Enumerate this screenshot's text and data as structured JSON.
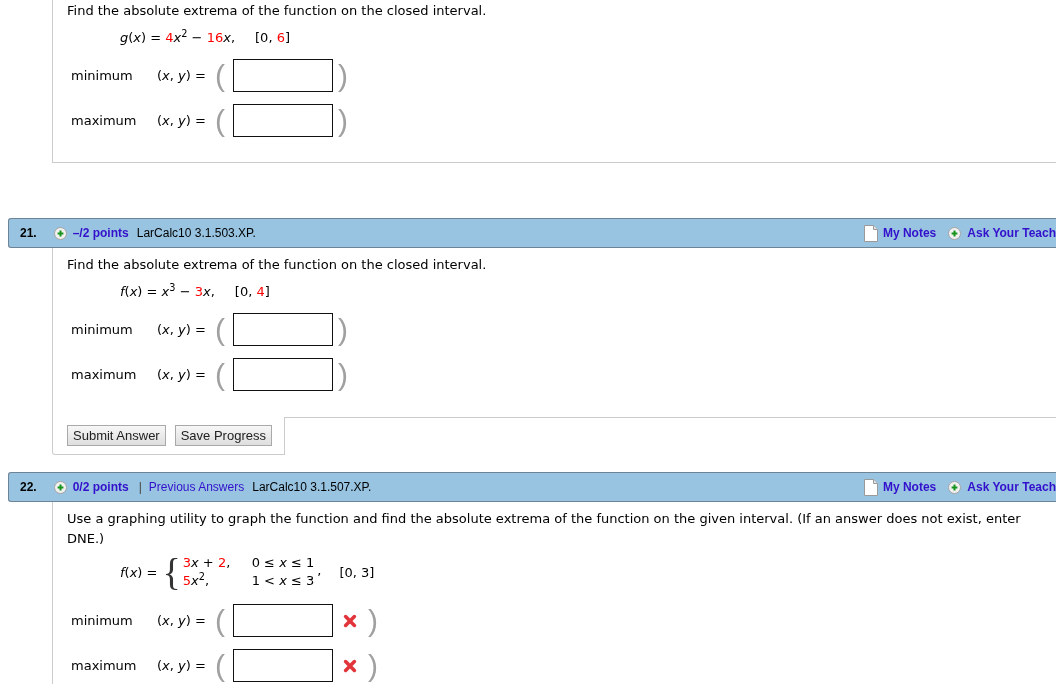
{
  "questions": [
    {
      "prompt": "Find the absolute extrema of the function on the closed interval.",
      "formula": {
        "kind": "simple",
        "parts": [
          {
            "text": "*g*(*x*) = "
          },
          {
            "text": "4",
            "color": "#ff0000"
          },
          {
            "text": "*x*$^{2}$ − "
          },
          {
            "text": "16",
            "color": "#ff0000"
          },
          {
            "text": "*x*,"
          }
        ],
        "interval": [
          {
            "text": "[0, "
          },
          {
            "text": "6",
            "color": "#ff0000"
          },
          {
            "text": "]"
          }
        ]
      },
      "answers": [
        {
          "label": "minimum",
          "point": "(*x*, *y*) =",
          "open": "(",
          "close": ")",
          "incorrect": false
        },
        {
          "label": "maximum",
          "point": "(*x*, *y*) =",
          "open": "(",
          "close": ")",
          "incorrect": false
        }
      ]
    },
    {
      "header": {
        "number": "21.",
        "points": "–/2 points",
        "source": "LarCalc10 3.1.503.XP.",
        "notes": "My Notes",
        "ask": "Ask Your Teach"
      },
      "prompt": "Find the absolute extrema of the function on the closed interval.",
      "formula": {
        "kind": "simple",
        "parts": [
          {
            "text": "*f*(*x*) = *x*$^{3}$ − "
          },
          {
            "text": "3",
            "color": "#ff0000"
          },
          {
            "text": "*x*,"
          }
        ],
        "interval": [
          {
            "text": "[0, "
          },
          {
            "text": "4",
            "color": "#ff0000"
          },
          {
            "text": "]"
          }
        ]
      },
      "answers": [
        {
          "label": "minimum",
          "point": "(*x*, *y*) =",
          "open": "(",
          "close": ")",
          "incorrect": false
        },
        {
          "label": "maximum",
          "point": "(*x*, *y*) =",
          "open": "(",
          "close": ")",
          "incorrect": false
        }
      ],
      "buttons": [
        "Submit Answer",
        "Save Progress"
      ]
    },
    {
      "header": {
        "number": "22.",
        "points": "0/2 points",
        "separator": "|",
        "previous": "Previous Answers",
        "source": "LarCalc10 3.1.507.XP.",
        "notes": "My Notes",
        "ask": "Ask Your Teach"
      },
      "prompt": "Use a graphing utility to graph the function and find the absolute extrema of the function on the given interval. (If an answer does not exist, enter DNE.)",
      "formula": {
        "kind": "piecewise",
        "lead": [
          {
            "text": "*f*(*x*) ="
          }
        ],
        "brace": "{",
        "cases": [
          {
            "expr": [
              {
                "text": "3",
                "color": "#ff0000"
              },
              {
                "text": "*x* + "
              },
              {
                "text": "2",
                "color": "#ff0000"
              },
              {
                "text": ","
              }
            ],
            "condition": "0 ≤ *x* ≤ 1"
          },
          {
            "expr": [
              {
                "text": "5",
                "color": "#ff0000"
              },
              {
                "text": "*x*$^{2}$,"
              }
            ],
            "condition": "1 < *x* ≤ 3"
          }
        ],
        "after": ",",
        "interval": [
          {
            "text": "[0, 3]"
          }
        ]
      },
      "answers": [
        {
          "label": "minimum",
          "point": "(*x*, *y*) =",
          "open": "(",
          "close": ")",
          "incorrect": true
        },
        {
          "label": "maximum",
          "point": "(*x*, *y*) =",
          "open": "(",
          "close": ")",
          "incorrect": true
        }
      ]
    }
  ]
}
